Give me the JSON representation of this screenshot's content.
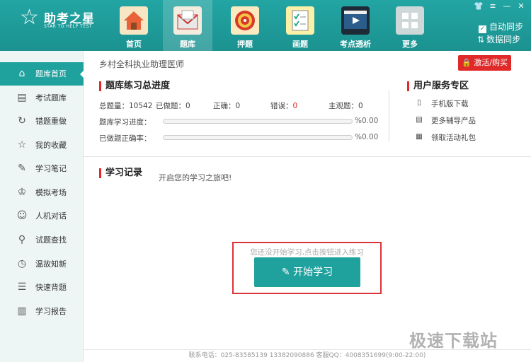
{
  "logo": {
    "title": "助考之星",
    "subtitle": "STAR TO HELP TEST"
  },
  "nav": [
    {
      "label": "首页",
      "icon": "home-icon"
    },
    {
      "label": "题库",
      "icon": "envelope-icon"
    },
    {
      "label": "押题",
      "icon": "target-icon"
    },
    {
      "label": "画题",
      "icon": "checklist-icon"
    },
    {
      "label": "考点透析",
      "icon": "video-icon"
    },
    {
      "label": "更多",
      "icon": "grid-icon"
    }
  ],
  "sync": {
    "auto": "自动同步",
    "data": "数据同步"
  },
  "sidebar": [
    {
      "label": "题库首页"
    },
    {
      "label": "考试题库"
    },
    {
      "label": "错题重做"
    },
    {
      "label": "我的收藏"
    },
    {
      "label": "学习笔记"
    },
    {
      "label": "模拟考场"
    },
    {
      "label": "人机对话"
    },
    {
      "label": "试题查找"
    },
    {
      "label": "温故知新"
    },
    {
      "label": "快速背题"
    },
    {
      "label": "学习报告"
    }
  ],
  "main": {
    "subject": "乡村全科执业助理医师",
    "activate": "激活/购买",
    "progress_title": "题库练习总进度",
    "stats": {
      "total": "总题量：10542",
      "done": "已做题：0",
      "correct_label": "正确：0",
      "wrong_label": "错误：",
      "wrong_value": "0",
      "subjective": "主观题：0"
    },
    "rows": [
      {
        "label": "题库学习进度：",
        "value": "%0.00",
        "fraction": 0
      },
      {
        "label": "已做题正确率：",
        "value": "%0.00",
        "fraction": 0
      }
    ],
    "service_title": "用户服务专区",
    "services": [
      {
        "label": "手机版下载",
        "icon": "phone-icon"
      },
      {
        "label": "更多辅导产品",
        "icon": "document-icon"
      },
      {
        "label": "领取活动礼包",
        "icon": "gift-icon"
      }
    ],
    "record_title": "学习记录",
    "record_hint": "开启您的学习之旅吧!",
    "tip": "您还没开始学习,点击按钮进入练习",
    "start": "开始学习"
  },
  "footer": "联系电话：025-83585139   13382090886  客服QQ：4008351699(9:00-22:00)",
  "watermark": "极速下载站",
  "colors": {
    "teal": "#1b9290",
    "accent_red": "#e02a2a"
  }
}
